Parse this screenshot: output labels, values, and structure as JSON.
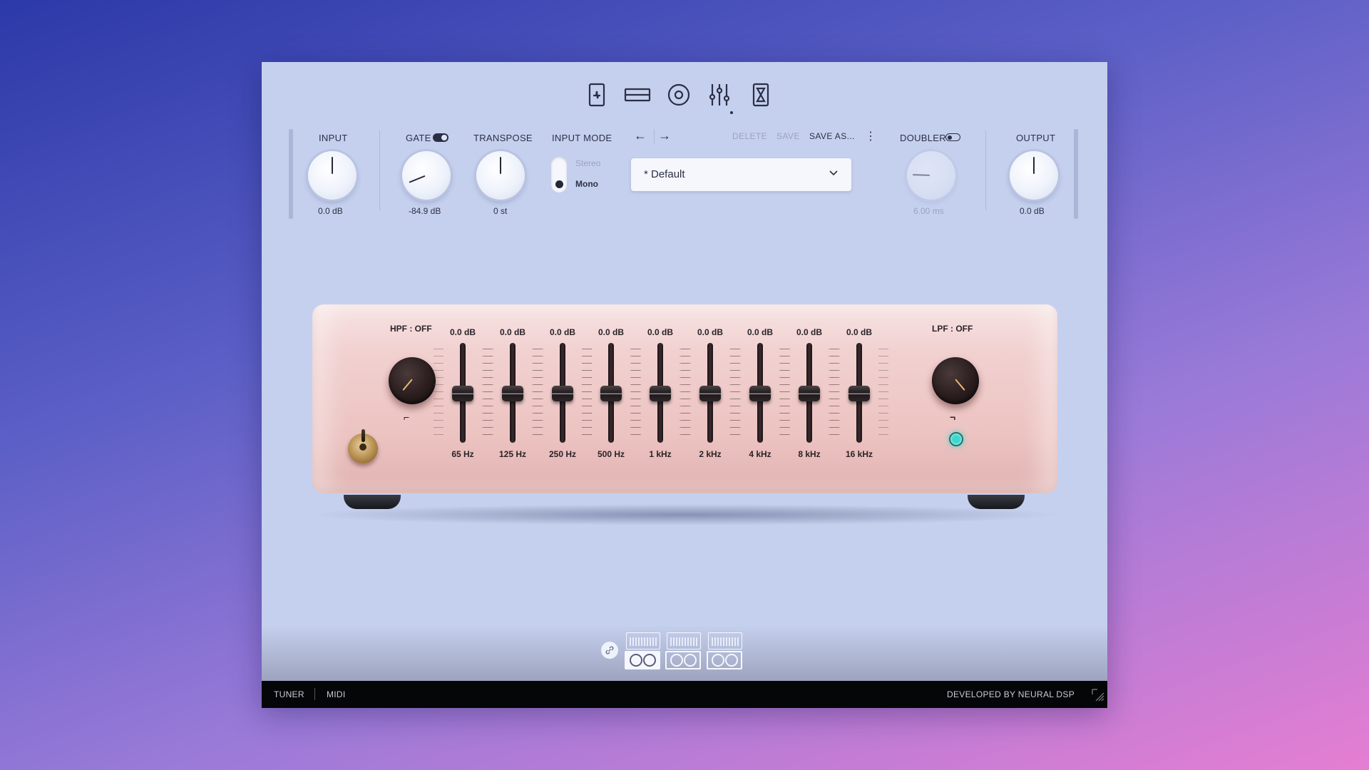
{
  "nav": {
    "icons": [
      "pedal-icon",
      "amp-icon",
      "cabinet-icon",
      "eq-icon",
      "hourglass-icon"
    ],
    "active": 3
  },
  "header": {
    "input": {
      "label": "INPUT",
      "value": "0.0 dB"
    },
    "gate": {
      "label": "GATE",
      "value": "-84.9 dB",
      "enabled": true
    },
    "transpose": {
      "label": "TRANSPOSE",
      "value": "0 st"
    },
    "input_mode": {
      "label": "INPUT MODE",
      "options": [
        "Stereo",
        "Mono"
      ],
      "selected": "Mono"
    },
    "preset": {
      "prev_arrow": "←",
      "next_arrow": "→",
      "delete_label": "DELETE",
      "save_label": "SAVE",
      "save_as_label": "SAVE AS...",
      "more_label": "⋮",
      "name": "* Default"
    },
    "doubler": {
      "label": "DOUBLER",
      "value": "6.00 ms",
      "enabled": false
    },
    "output": {
      "label": "OUTPUT",
      "value": "0.0 dB"
    }
  },
  "eq": {
    "hpf_label": "HPF : OFF",
    "lpf_label": "LPF : OFF",
    "hpf_glyph": "⌐",
    "lpf_glyph": "¬",
    "led_color": "#3ed7cf",
    "bands": [
      {
        "freq": "65 Hz",
        "gain": "0.0 dB"
      },
      {
        "freq": "125 Hz",
        "gain": "0.0 dB"
      },
      {
        "freq": "250 Hz",
        "gain": "0.0 dB"
      },
      {
        "freq": "500 Hz",
        "gain": "0.0 dB"
      },
      {
        "freq": "1 kHz",
        "gain": "0.0 dB"
      },
      {
        "freq": "2 kHz",
        "gain": "0.0 dB"
      },
      {
        "freq": "4 kHz",
        "gain": "0.0 dB"
      },
      {
        "freq": "8 kHz",
        "gain": "0.0 dB"
      },
      {
        "freq": "16 kHz",
        "gain": "0.0 dB"
      }
    ]
  },
  "chain": {
    "link_icon": "link-icon",
    "amps": [
      "amp-1-icon",
      "amp-2-icon",
      "amp-3-icon"
    ],
    "active": 0
  },
  "status": {
    "tuner": "TUNER",
    "midi": "MIDI",
    "credit": "DEVELOPED BY NEURAL DSP"
  },
  "colors": {
    "background_start": "#2c39a8",
    "background_end": "#e57ed2",
    "panel": "#c5d0ee",
    "eq_body": "#ecc3c1",
    "text_dark": "#2c3044"
  }
}
